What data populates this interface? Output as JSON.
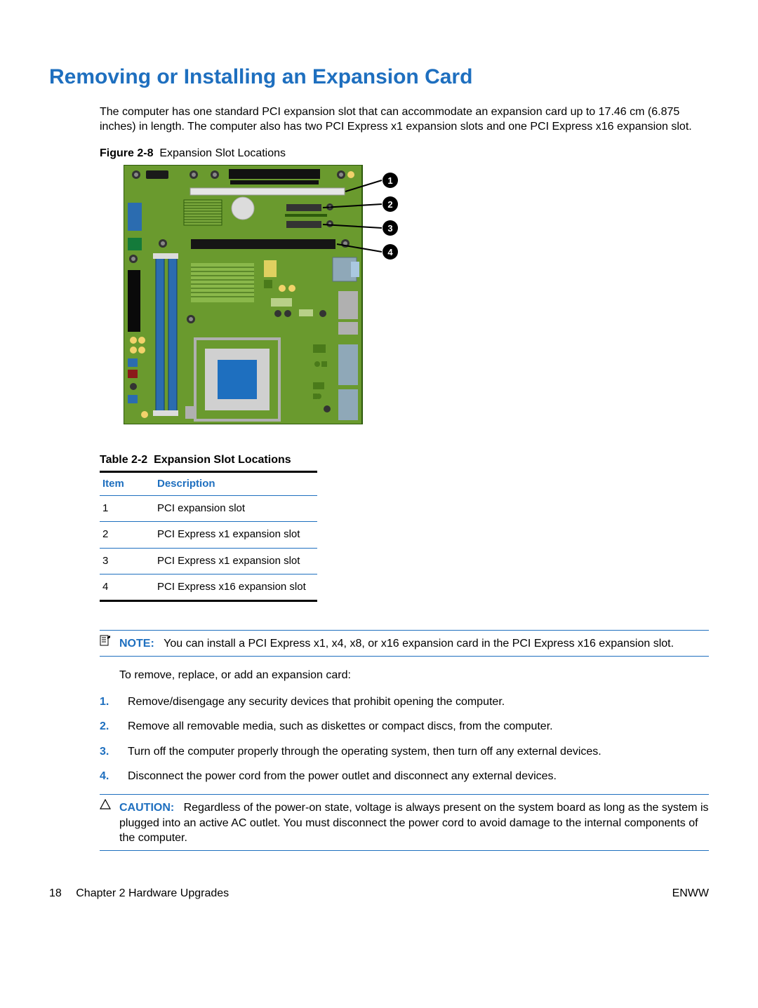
{
  "title": "Removing or Installing an Expansion Card",
  "intro": "The computer has one standard PCI expansion slot that can accommodate an expansion card up to 17.46 cm (6.875 inches) in length. The computer also has two PCI Express x1 expansion slots and one PCI Express x16 expansion slot.",
  "figure": {
    "label": "Figure 2-8",
    "caption": "Expansion Slot Locations"
  },
  "callouts": [
    "1",
    "2",
    "3",
    "4"
  ],
  "table": {
    "label": "Table 2-2",
    "caption": "Expansion Slot Locations",
    "headers": {
      "item": "Item",
      "description": "Description"
    },
    "rows": [
      {
        "item": "1",
        "description": "PCI expansion slot"
      },
      {
        "item": "2",
        "description": "PCI Express x1 expansion slot"
      },
      {
        "item": "3",
        "description": "PCI Express x1 expansion slot"
      },
      {
        "item": "4",
        "description": "PCI Express x16 expansion slot"
      }
    ]
  },
  "note": {
    "label": "NOTE:",
    "text": "You can install a PCI Express x1, x4, x8, or x16 expansion card in the PCI Express x16 expansion slot."
  },
  "lead_in": "To remove, replace, or add an expansion card:",
  "steps": [
    "Remove/disengage any security devices that prohibit opening the computer.",
    "Remove all removable media, such as diskettes or compact discs, from the computer.",
    "Turn off the computer properly through the operating system, then turn off any external devices.",
    "Disconnect the power cord from the power outlet and disconnect any external devices."
  ],
  "caution": {
    "label": "CAUTION:",
    "text": "Regardless of the power-on state, voltage is always present on the system board as long as the system is plugged into an active AC outlet. You must disconnect the power cord to avoid damage to the internal components of the computer."
  },
  "footer": {
    "page_number": "18",
    "chapter": "Chapter 2   Hardware Upgrades",
    "right": "ENWW"
  }
}
